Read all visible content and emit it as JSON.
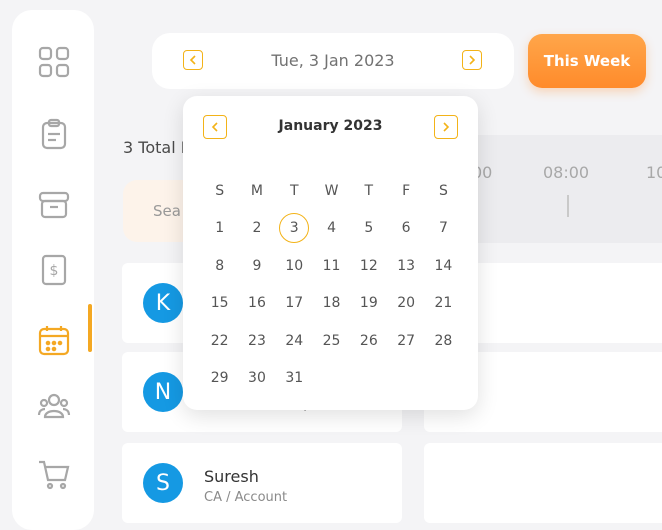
{
  "sidebar": {
    "icons": [
      "dashboard-icon",
      "clipboard-icon",
      "archive-icon",
      "invoice-icon",
      "calendar-icon",
      "users-icon",
      "cart-icon"
    ],
    "active_index": 4,
    "accent": "#f4a823"
  },
  "date_nav": {
    "current_date": "Tue, 3 Jan 2023"
  },
  "this_week_label": "This Week",
  "total_label": "3 Total E",
  "search": {
    "placeholder": "Sea"
  },
  "timeline": {
    "times": [
      "00",
      "08:00",
      "10"
    ]
  },
  "employees": [
    {
      "initial": "K",
      "name": "",
      "role": ""
    },
    {
      "initial": "N",
      "name": "",
      "role": "Associate Chef / Kitchen"
    },
    {
      "initial": "S",
      "name": "Suresh",
      "role": "CA / Account"
    }
  ],
  "calendar": {
    "month_label": "January 2023",
    "weekdays": [
      "S",
      "M",
      "T",
      "W",
      "T",
      "F",
      "S"
    ],
    "weeks": [
      [
        "1",
        "2",
        "3",
        "4",
        "5",
        "6",
        "7"
      ],
      [
        "8",
        "9",
        "10",
        "11",
        "12",
        "13",
        "14"
      ],
      [
        "15",
        "16",
        "17",
        "18",
        "19",
        "20",
        "21"
      ],
      [
        "22",
        "23",
        "24",
        "25",
        "26",
        "27",
        "28"
      ],
      [
        "29",
        "30",
        "31",
        "",
        "",
        "",
        ""
      ]
    ],
    "selected_day": "3",
    "accent": "#f3b318"
  }
}
